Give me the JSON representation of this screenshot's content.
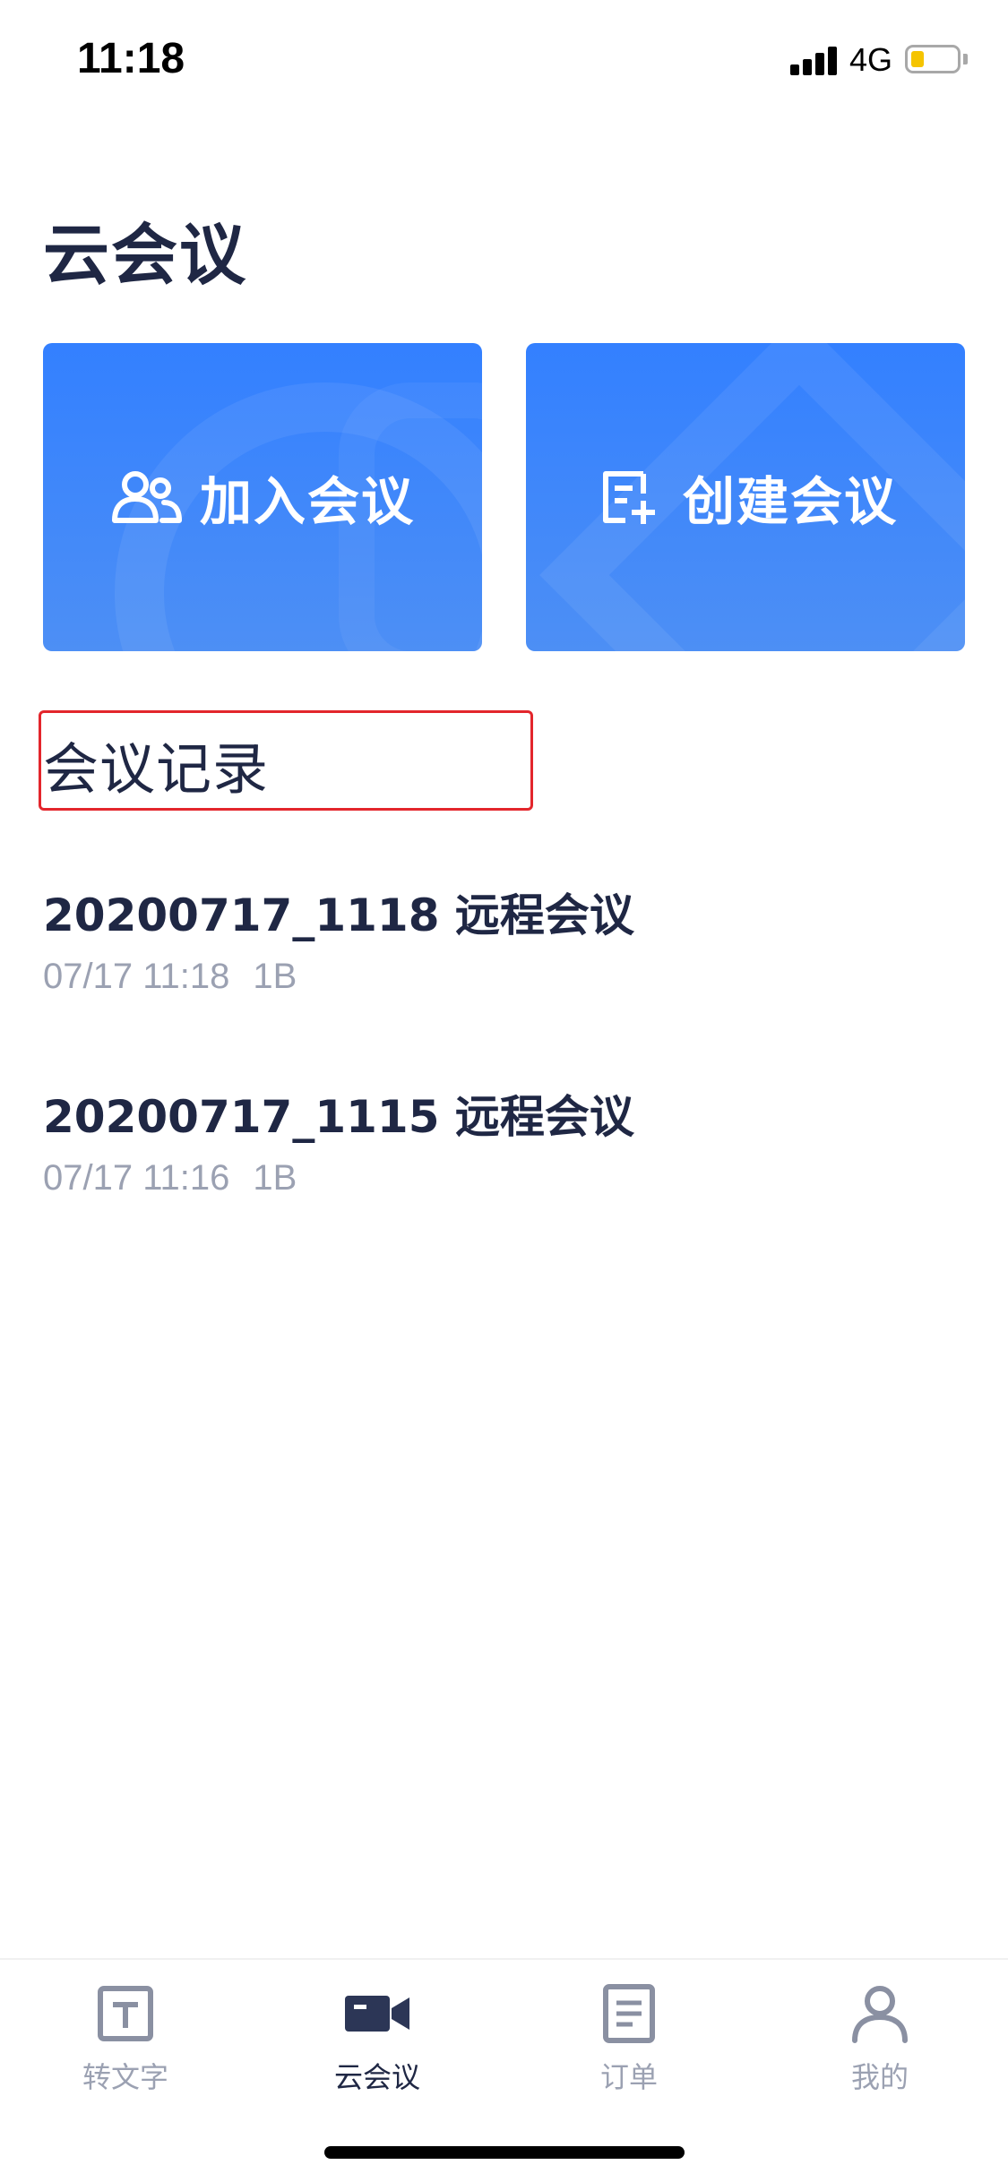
{
  "status_bar": {
    "time": "11:18",
    "network": "4G",
    "battery_level": 0.3,
    "battery_color": "#f5c400"
  },
  "page": {
    "title": "云会议"
  },
  "actions": {
    "join": {
      "label": "加入会议",
      "icon": "users-icon"
    },
    "create": {
      "label": "创建会议",
      "icon": "edit-add-icon"
    },
    "accent_color": "#3380ff"
  },
  "records": {
    "heading": "会议记录",
    "items": [
      {
        "title": "20200717_1118 远程会议",
        "date": "07/17 11:18",
        "size": "1B"
      },
      {
        "title": "20200717_1115 远程会议",
        "date": "07/17 11:16",
        "size": "1B"
      }
    ]
  },
  "tabs": [
    {
      "label": "转文字",
      "icon": "text-icon",
      "active": false
    },
    {
      "label": "云会议",
      "icon": "video-camera-icon",
      "active": true
    },
    {
      "label": "订单",
      "icon": "order-list-icon",
      "active": false
    },
    {
      "label": "我的",
      "icon": "profile-icon",
      "active": false
    }
  ]
}
